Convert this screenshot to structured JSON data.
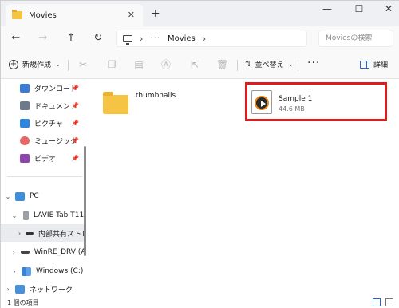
{
  "window": {
    "tab_title": "Movies",
    "close_tab_glyph": "✕",
    "new_tab_glyph": "+",
    "minimize_glyph": "—",
    "maximize_glyph": "☐",
    "close_glyph": "✕"
  },
  "nav": {
    "back_glyph": "←",
    "forward_glyph": "→",
    "up_glyph": "↑",
    "refresh_glyph": "↻",
    "breadcrumb_more": "···",
    "breadcrumb_current": "Movies",
    "separator": "›",
    "search_placeholder": "Moviesの検索"
  },
  "commandbar": {
    "new_label": "新規作成",
    "new_chevron": "⌄",
    "sort_label": "並べ替え",
    "sort_chevron": "⌄",
    "more_glyph": "···",
    "details_label": "詳細",
    "icons": [
      "cut-icon",
      "copy-icon",
      "paste-icon",
      "rename-icon",
      "share-icon",
      "delete-icon"
    ]
  },
  "sidebar": {
    "quick_access": [
      {
        "label": "ダウンロード",
        "icon": "download-icon",
        "color": "#3a7bd5"
      },
      {
        "label": "ドキュメント",
        "icon": "documents-icon",
        "color": "#6c7a89"
      },
      {
        "label": "ピクチャ",
        "icon": "pictures-icon",
        "color": "#2e86de"
      },
      {
        "label": "ミュージック",
        "icon": "music-icon",
        "color": "#e66767"
      },
      {
        "label": "ビデオ",
        "icon": "videos-icon",
        "color": "#8e44ad"
      }
    ],
    "tree": [
      {
        "label": "PC",
        "chevron": "⌄",
        "icon": "pc-icon"
      },
      {
        "label": "LAVIE Tab T11",
        "chevron": "⌄",
        "icon": "tablet-icon"
      },
      {
        "label": "内部共有ストレージ",
        "chevron": "›",
        "icon": "storage-icon"
      },
      {
        "label": "WinRE_DRV (A:)",
        "chevron": "›",
        "icon": "drive-icon"
      },
      {
        "label": "Windows (C:)",
        "chevron": "›",
        "icon": "windows-drive-icon"
      },
      {
        "label": "ネットワーク",
        "chevron": "›",
        "icon": "network-icon"
      }
    ],
    "pin_glyph": "📌"
  },
  "content": {
    "folder": {
      "name": ".thumbnails",
      "icon": "folder-icon"
    },
    "file": {
      "name": "Sample 1",
      "size": "44.6 MB",
      "icon": "video-file-icon"
    }
  },
  "status": {
    "item_count": "1 個の項目"
  },
  "colors": {
    "accent": "#2b66c6",
    "highlight_border": "#e01b1b",
    "folder_yellow": "#f6c443"
  }
}
